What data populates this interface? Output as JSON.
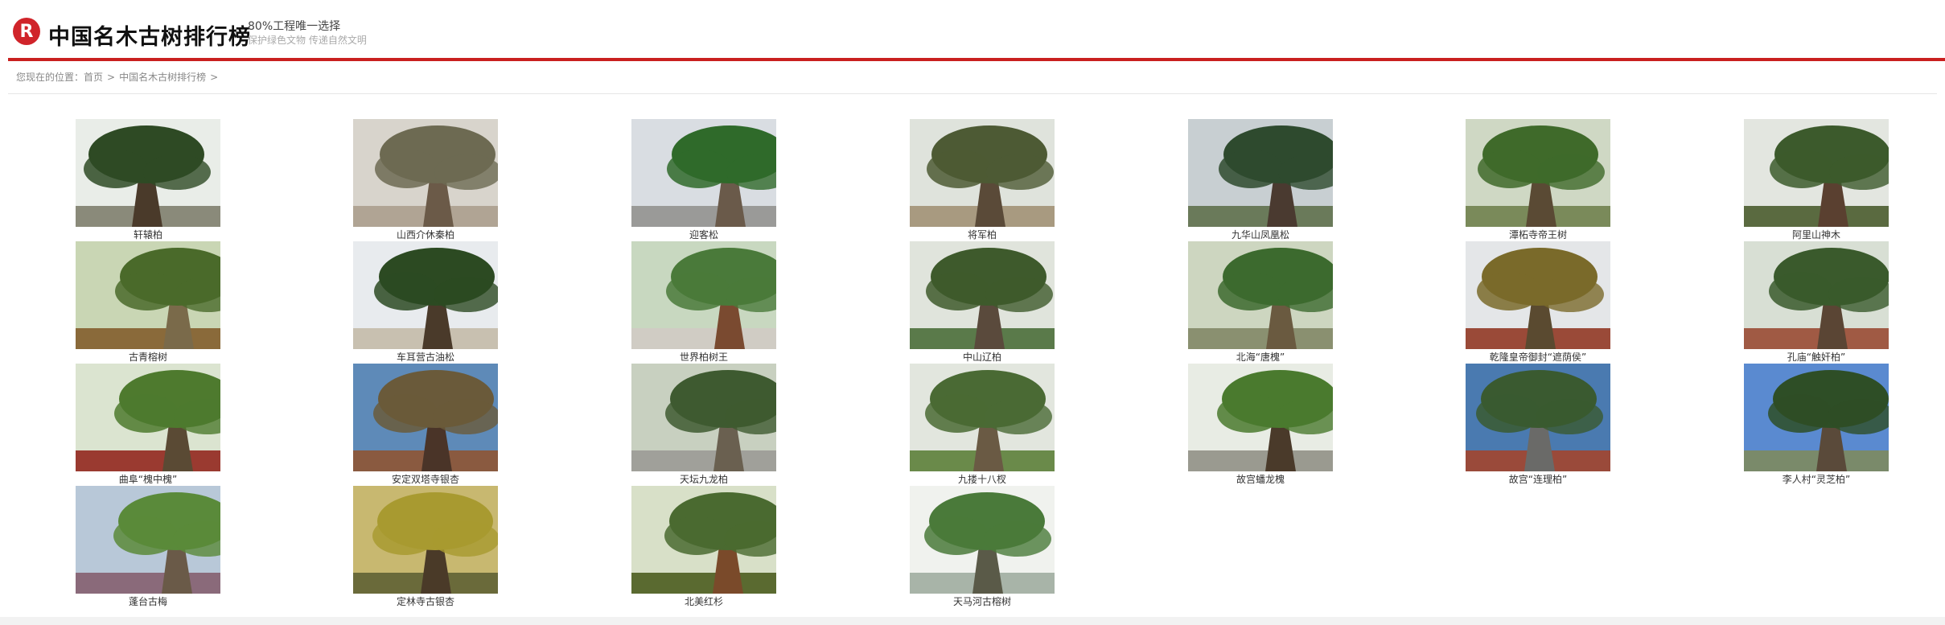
{
  "header": {
    "logo_letter": "R",
    "title": "中国名木古树排行榜",
    "slogan": "80%工程唯一选择",
    "slogan_sub": "保护绿色文物 传递自然文明"
  },
  "breadcrumb": {
    "prefix": "您现在的位置：",
    "home": "首页",
    "current": "中国名木古树排行榜",
    "separator": ">"
  },
  "trees": [
    {
      "name": "轩辕柏",
      "sky": "#e9ede8",
      "foliage": "#2e4a24",
      "trunk": "#4a3a2a",
      "ground": "#8a8a7a"
    },
    {
      "name": "山西介休秦柏",
      "sky": "#d8d4cc",
      "foliage": "#6d6a52",
      "trunk": "#6b5a48",
      "ground": "#b0a494"
    },
    {
      "name": "迎客松",
      "sky": "#d9dde2",
      "foliage": "#2f6a2a",
      "trunk": "#6a5a4a",
      "ground": "#9a9a98"
    },
    {
      "name": "将军柏",
      "sky": "#dfe3dc",
      "foliage": "#4d5a34",
      "trunk": "#5a4a38",
      "ground": "#a89a80"
    },
    {
      "name": "九华山凤凰松",
      "sky": "#c8cfd2",
      "foliage": "#2e4a2e",
      "trunk": "#4a3a30",
      "ground": "#6a7a5a"
    },
    {
      "name": "潭柘寺帝王树",
      "sky": "#cfd8c4",
      "foliage": "#3f6a2a",
      "trunk": "#5a4a34",
      "ground": "#7a8a5a"
    },
    {
      "name": "阿里山神木",
      "sky": "#e3e6e0",
      "foliage": "#3c5a2c",
      "trunk": "#5a4030",
      "ground": "#5a6a40"
    },
    {
      "name": "古青榕树",
      "sky": "#c9d6b4",
      "foliage": "#4a6a2a",
      "trunk": "#7a6a4a",
      "ground": "#8a6a3a"
    },
    {
      "name": "车耳营古油松",
      "sky": "#e8ebee",
      "foliage": "#2c4a22",
      "trunk": "#4a3a2a",
      "ground": "#c8c0b0"
    },
    {
      "name": "世界柏树王",
      "sky": "#c8d8c0",
      "foliage": "#4a7a3a",
      "trunk": "#7a4a30",
      "ground": "#d0ccc4"
    },
    {
      "name": "中山辽柏",
      "sky": "#e0e4dc",
      "foliage": "#3e5a2c",
      "trunk": "#5a4a3c",
      "ground": "#5a7a4a"
    },
    {
      "name": "北海“唐槐”",
      "sky": "#cdd6c0",
      "foliage": "#3c6a2e",
      "trunk": "#6a5a40",
      "ground": "#8a9070"
    },
    {
      "name": "乾隆皇帝御封“遮荫侯”",
      "sky": "#e4e6e8",
      "foliage": "#7a6a2a",
      "trunk": "#5a4a30",
      "ground": "#9a4a38"
    },
    {
      "name": "孔庙“触奸柏”",
      "sky": "#d8dfd4",
      "foliage": "#3a5a2c",
      "trunk": "#5a4534",
      "ground": "#a05a44"
    },
    {
      "name": "曲阜“槐中槐”",
      "sky": "#dbe4d0",
      "foliage": "#4e7a2e",
      "trunk": "#5a4a34",
      "ground": "#9a3a30"
    },
    {
      "name": "安定双塔寺银杏",
      "sky": "#5e8ab8",
      "foliage": "#6a5a3a",
      "trunk": "#4a3428",
      "ground": "#8a5a40"
    },
    {
      "name": "天坛九龙柏",
      "sky": "#c8d0c0",
      "foliage": "#3e5a30",
      "trunk": "#6a6050",
      "ground": "#a0a09a"
    },
    {
      "name": "九搂十八杈",
      "sky": "#e2e6de",
      "foliage": "#4a6a34",
      "trunk": "#6a5a44",
      "ground": "#6a8a4a"
    },
    {
      "name": "故宫蟠龙槐",
      "sky": "#e8ece4",
      "foliage": "#4a7a2e",
      "trunk": "#4a3a2a",
      "ground": "#9a9a90"
    },
    {
      "name": "故宫“连理柏”",
      "sky": "#4a7ab0",
      "foliage": "#3a5a30",
      "trunk": "#6a6a68",
      "ground": "#9a4a3a"
    },
    {
      "name": "李人村“灵芝柏”",
      "sky": "#5a8ad0",
      "foliage": "#2e4e26",
      "trunk": "#5a4a3a",
      "ground": "#7a8a6a"
    },
    {
      "name": "蓬台古梅",
      "sky": "#b8c8d8",
      "foliage": "#5a8a3a",
      "trunk": "#6a5a48",
      "ground": "#8a6a7a"
    },
    {
      "name": "定林寺古银杏",
      "sky": "#c8b870",
      "foliage": "#a89a30",
      "trunk": "#4a3a28",
      "ground": "#6a6a3a"
    },
    {
      "name": "北美红杉",
      "sky": "#d8e0c8",
      "foliage": "#4a6a30",
      "trunk": "#7a4a2a",
      "ground": "#5a6a30"
    },
    {
      "name": "天马河古榕树",
      "sky": "#f0f2ee",
      "foliage": "#4a7a3a",
      "trunk": "#5a5a48",
      "ground": "#a8b4a8"
    }
  ]
}
